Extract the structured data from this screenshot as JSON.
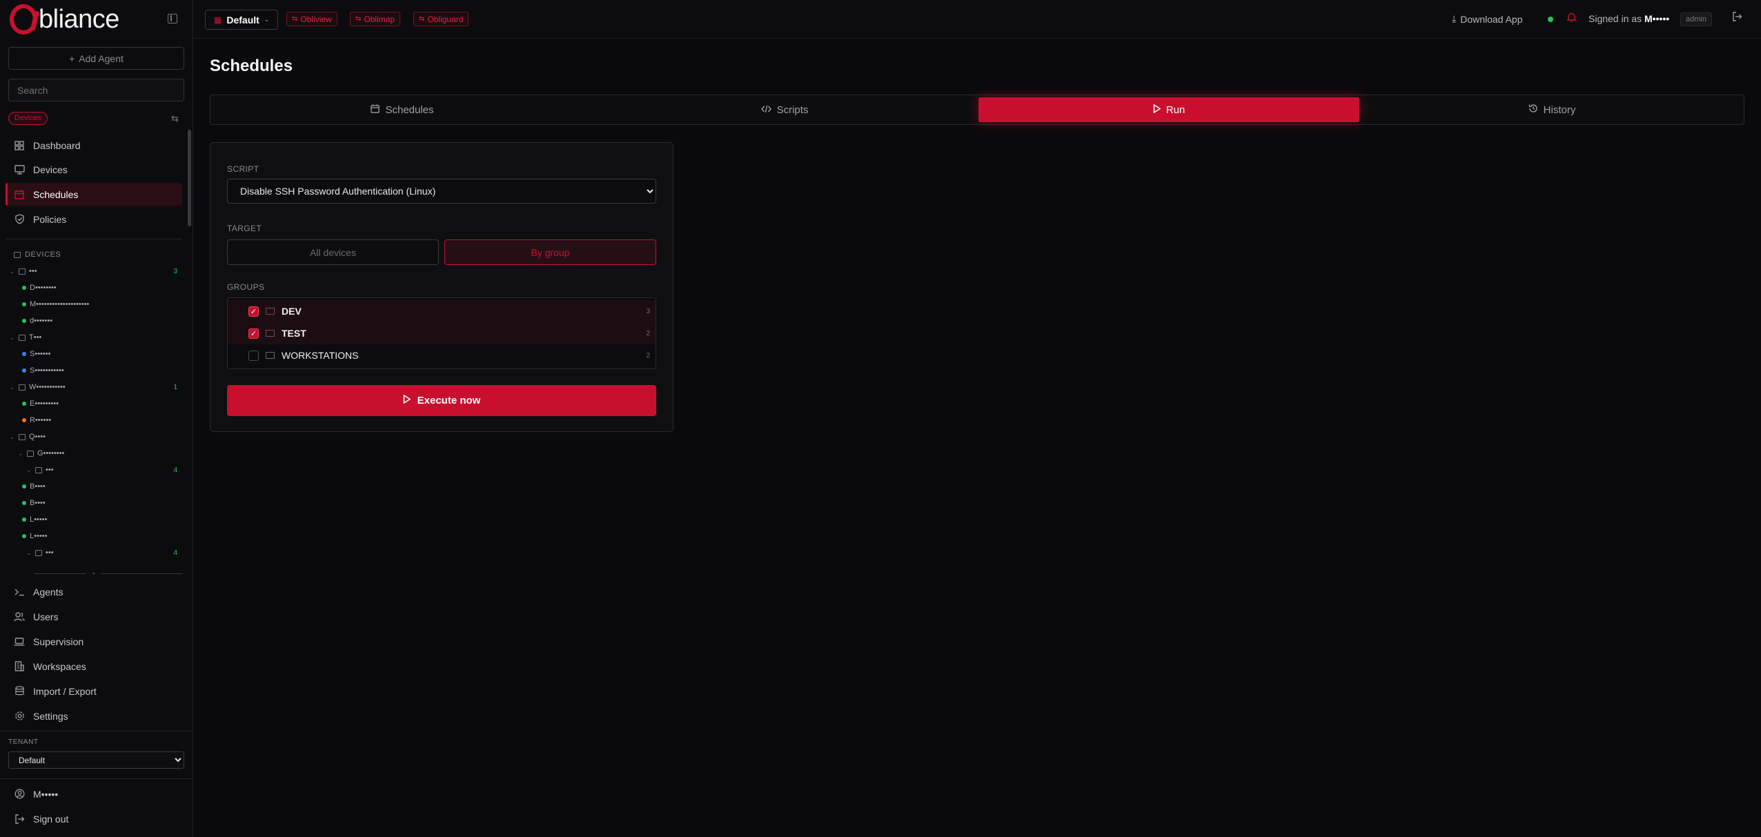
{
  "brand": {
    "logo_o": "O",
    "logo_text": "bliance"
  },
  "sidebar": {
    "add_agent": "Add Agent",
    "search_placeholder": "Search",
    "filter_chip": "Devices",
    "nav_top": [
      {
        "label": "Dashboard",
        "icon": "dashboard-icon"
      },
      {
        "label": "Devices",
        "icon": "monitor-icon"
      },
      {
        "label": "Schedules",
        "icon": "calendar-icon",
        "active": true
      },
      {
        "label": "Policies",
        "icon": "shield-icon"
      }
    ],
    "devices_section": "DEVICES",
    "tree": [
      {
        "label": "•••",
        "count": "3"
      },
      {
        "label": "D••••••••"
      },
      {
        "label": "M••••••••••••••••••••"
      },
      {
        "label": "d•••••••"
      },
      {
        "label": "T•••"
      },
      {
        "label": "S••••••"
      },
      {
        "label": "S•••••••••••"
      },
      {
        "label": "W•••••••••••",
        "count": "1"
      },
      {
        "label": "E•••••••••"
      },
      {
        "label": "R••••••"
      },
      {
        "label": "Q••••"
      },
      {
        "label": "G••••••••"
      },
      {
        "label": "•••",
        "count": "4"
      },
      {
        "label": "B••••"
      },
      {
        "label": "B••••"
      },
      {
        "label": "L•••••"
      },
      {
        "label": "L•••••"
      },
      {
        "label": "•••",
        "count": "4"
      }
    ],
    "nav_bottom": [
      {
        "label": "Agents",
        "icon": "terminal-icon"
      },
      {
        "label": "Users",
        "icon": "users-icon"
      },
      {
        "label": "Supervision",
        "icon": "laptop-icon"
      },
      {
        "label": "Workspaces",
        "icon": "building-icon"
      },
      {
        "label": "Import / Export",
        "icon": "transfer-icon"
      },
      {
        "label": "Settings",
        "icon": "gear-icon"
      }
    ],
    "tenant_label": "TENANT",
    "tenant_value": "Default",
    "user_name": "M•••••",
    "sign_out": "Sign out"
  },
  "topbar": {
    "workspace": "Default",
    "apps": [
      "Obliview",
      "Oblimap",
      "Obliguard"
    ],
    "download": "Download App",
    "signed_in_prefix": "Signed in as",
    "signed_in_user": "M•••••",
    "role": "admin"
  },
  "main": {
    "title": "Schedules",
    "tabs": [
      {
        "label": "Schedules",
        "icon": "calendar-icon"
      },
      {
        "label": "Scripts",
        "icon": "code-icon"
      },
      {
        "label": "Run",
        "icon": "play-icon",
        "active": true
      },
      {
        "label": "History",
        "icon": "history-icon"
      }
    ],
    "script_label": "SCRIPT",
    "script_value": "Disable SSH Password Authentication (Linux)",
    "target_label": "TARGET",
    "target_all": "All devices",
    "target_group": "By group",
    "groups_label": "GROUPS",
    "groups": [
      {
        "name": "DEV",
        "count": "3",
        "checked": true
      },
      {
        "name": "TEST",
        "count": "2",
        "checked": true
      },
      {
        "name": "WORKSTATIONS",
        "count": "2",
        "checked": false
      }
    ],
    "execute": "Execute now"
  },
  "colors": {
    "accent": "#c8102e",
    "online": "#22c55e",
    "background": "#0a0a0c"
  }
}
